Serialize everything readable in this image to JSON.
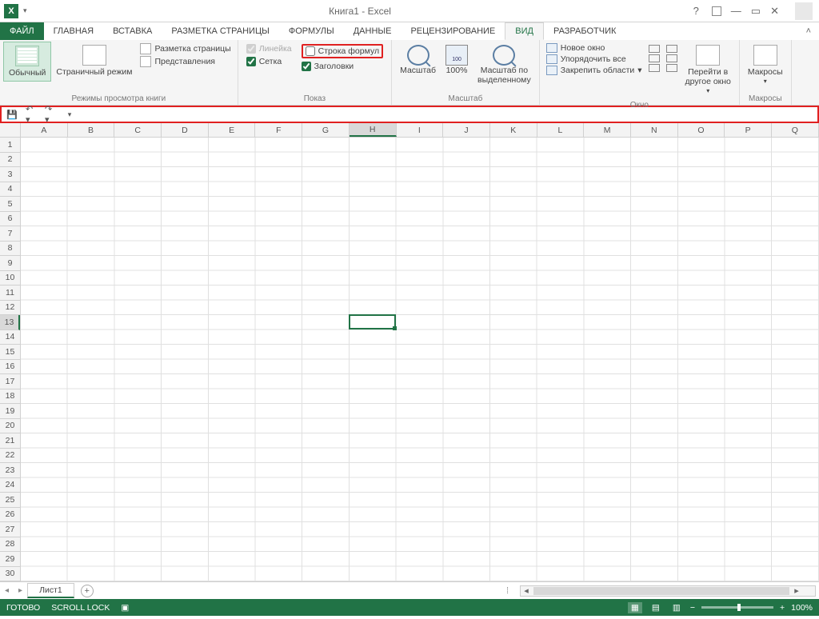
{
  "title": "Книга1 - Excel",
  "tabs": {
    "file": "ФАЙЛ",
    "items": [
      "ГЛАВНАЯ",
      "ВСТАВКА",
      "РАЗМЕТКА СТРАНИЦЫ",
      "ФОРМУЛЫ",
      "ДАННЫЕ",
      "РЕЦЕНЗИРОВАНИЕ",
      "ВИД",
      "РАЗРАБОТЧИК"
    ],
    "active": "ВИД"
  },
  "ribbon": {
    "views": {
      "normal": "Обычный",
      "page_break": "Страничный режим",
      "page_layout": "Разметка страницы",
      "custom_views": "Представления",
      "group": "Режимы просмотра книги"
    },
    "show": {
      "ruler": "Линейка",
      "formula_bar": "Строка формул",
      "gridlines": "Сетка",
      "headings": "Заголовки",
      "group": "Показ"
    },
    "zoom": {
      "zoom": "Масштаб",
      "hundred": "100%",
      "to_selection_l1": "Масштаб по",
      "to_selection_l2": "выделенному",
      "group": "Масштаб"
    },
    "window": {
      "new_window": "Новое окно",
      "arrange": "Упорядочить все",
      "freeze": "Закрепить области",
      "switch_l1": "Перейти в",
      "switch_l2": "другое окно",
      "group": "Окно"
    },
    "macros": {
      "macros": "Макросы",
      "group": "Макросы"
    }
  },
  "columns": [
    "A",
    "B",
    "C",
    "D",
    "E",
    "F",
    "G",
    "H",
    "I",
    "J",
    "K",
    "L",
    "M",
    "N",
    "O",
    "P",
    "Q"
  ],
  "rows_count": 30,
  "selected": {
    "col": "H",
    "row": 13,
    "col_index": 7,
    "row_index": 12
  },
  "sheet": {
    "name": "Лист1"
  },
  "status": {
    "ready": "ГОТОВО",
    "scroll_lock": "SCROLL LOCK",
    "zoom": "100%"
  },
  "help_glyph": "?"
}
